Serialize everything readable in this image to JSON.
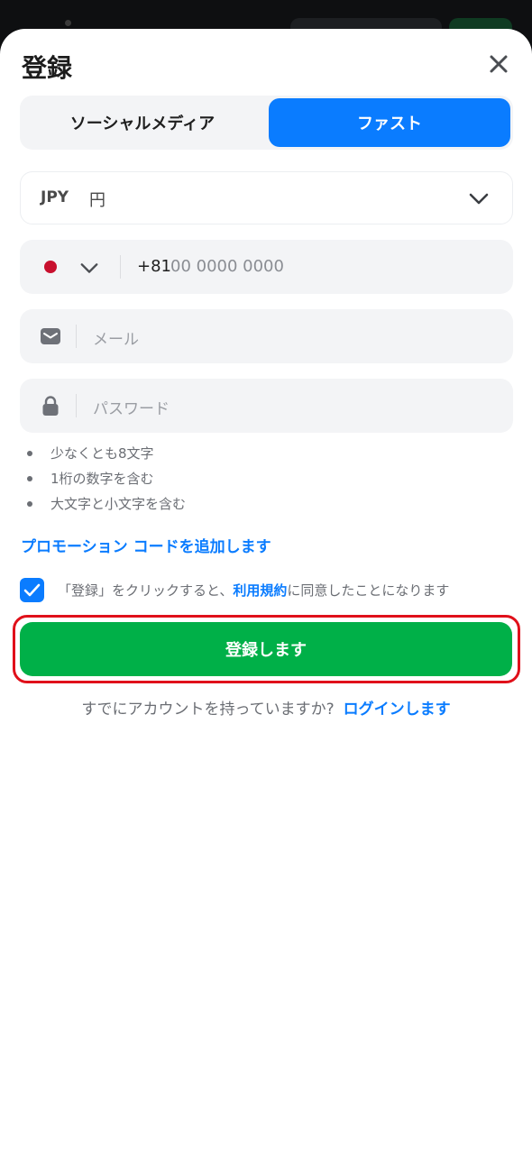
{
  "header": {
    "title": "登録"
  },
  "tabs": [
    {
      "label": "ソーシャルメディア",
      "active": false
    },
    {
      "label": "ファスト",
      "active": true
    }
  ],
  "currency": {
    "code": "JPY",
    "symbol": "円"
  },
  "phone": {
    "country_flag": "japan-flag",
    "prefix": "+81",
    "placeholder": "00 0000 0000"
  },
  "email": {
    "placeholder": "メール"
  },
  "password": {
    "placeholder": "パスワード",
    "rules": [
      "少なくとも8文字",
      "1桁の数字を含む",
      "大文字と小文字を含む"
    ]
  },
  "promo": {
    "label": "プロモーション コードを追加します"
  },
  "agreement": {
    "checked": true,
    "text_before": "「登録」をクリックすると、",
    "link": "利用規約",
    "text_after": "に同意したことになります"
  },
  "register_button": {
    "label": "登録します"
  },
  "login": {
    "prompt": "すでにアカウントを持っていますか?",
    "link": "ログインします"
  },
  "colors": {
    "accent": "#0a7cff",
    "primary_button": "#00b048",
    "highlight": "#e0101a"
  }
}
